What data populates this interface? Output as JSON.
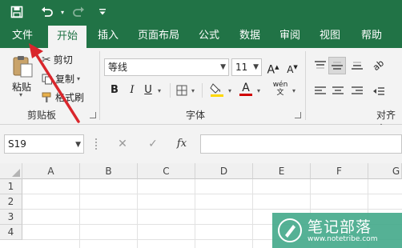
{
  "qat": {
    "save_icon": "save-icon",
    "undo_icon": "undo-icon",
    "redo_icon": "redo-icon",
    "customize_icon": "customize-qat-icon"
  },
  "tabs": [
    {
      "label": "文件"
    },
    {
      "label": "开始"
    },
    {
      "label": "插入"
    },
    {
      "label": "页面布局"
    },
    {
      "label": "公式"
    },
    {
      "label": "数据"
    },
    {
      "label": "审阅"
    },
    {
      "label": "视图"
    },
    {
      "label": "帮助"
    }
  ],
  "clipboard": {
    "paste_label": "粘贴",
    "cut_label": "剪切",
    "copy_label": "复制",
    "format_painter_label": "格式刷",
    "group_label": "剪贴板"
  },
  "font": {
    "font_name": "等线",
    "font_size": "11",
    "bold": "B",
    "italic": "I",
    "underline": "U",
    "font_color_letter": "A",
    "group_label": "字体",
    "highlight_color": "#ffd800",
    "font_color": "#d00000"
  },
  "alignment": {
    "group_label": "对齐方"
  },
  "formula_bar": {
    "name_box": "S19",
    "fx_label": "fx"
  },
  "grid": {
    "columns": [
      "A",
      "B",
      "C",
      "D",
      "E",
      "F",
      "G"
    ],
    "rows": [
      "1",
      "2",
      "3",
      "4"
    ]
  },
  "watermark": {
    "title": "笔记部落",
    "url": "www.notetribe.com"
  },
  "colors": {
    "excel_green": "#217346",
    "annotation_arrow": "#d9262c"
  }
}
